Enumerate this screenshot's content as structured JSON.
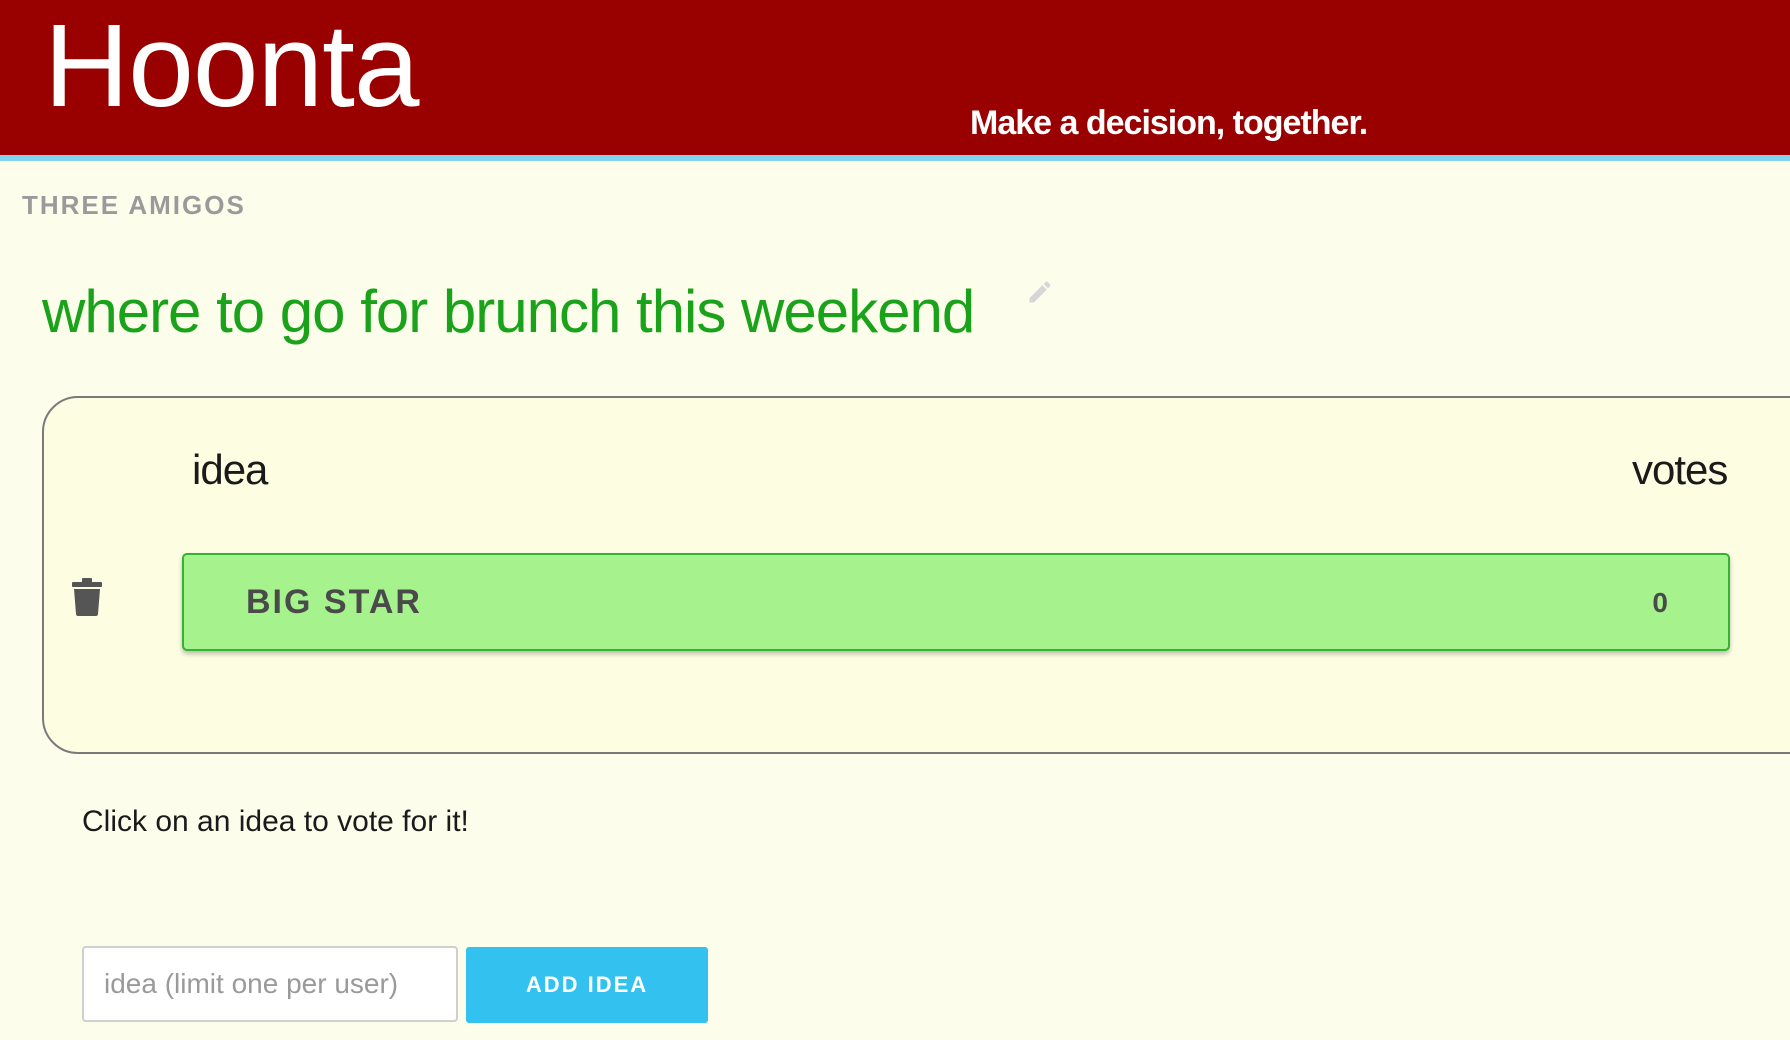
{
  "header": {
    "brand": "Hoonta",
    "tagline": "Make a decision, together.",
    "background_color": "#990000",
    "accent_border_color": "#7fd4ee"
  },
  "group": {
    "name": "THREE AMIGOS"
  },
  "question": {
    "text": "where to go for brunch this weekend",
    "color": "#1aa31a",
    "edit_icon": "pencil-icon"
  },
  "ideas_table": {
    "columns": {
      "idea": "idea",
      "votes": "votes"
    },
    "rows": [
      {
        "name": "BIG STAR",
        "votes": "0",
        "delete_icon": "trash-icon"
      }
    ],
    "row_color": "#a6f38e"
  },
  "hint": "Click on an idea to vote for it!",
  "new_idea": {
    "placeholder": "idea (limit one per user)",
    "value": "",
    "button_label": "ADD IDEA",
    "button_color": "#33c2ef"
  }
}
